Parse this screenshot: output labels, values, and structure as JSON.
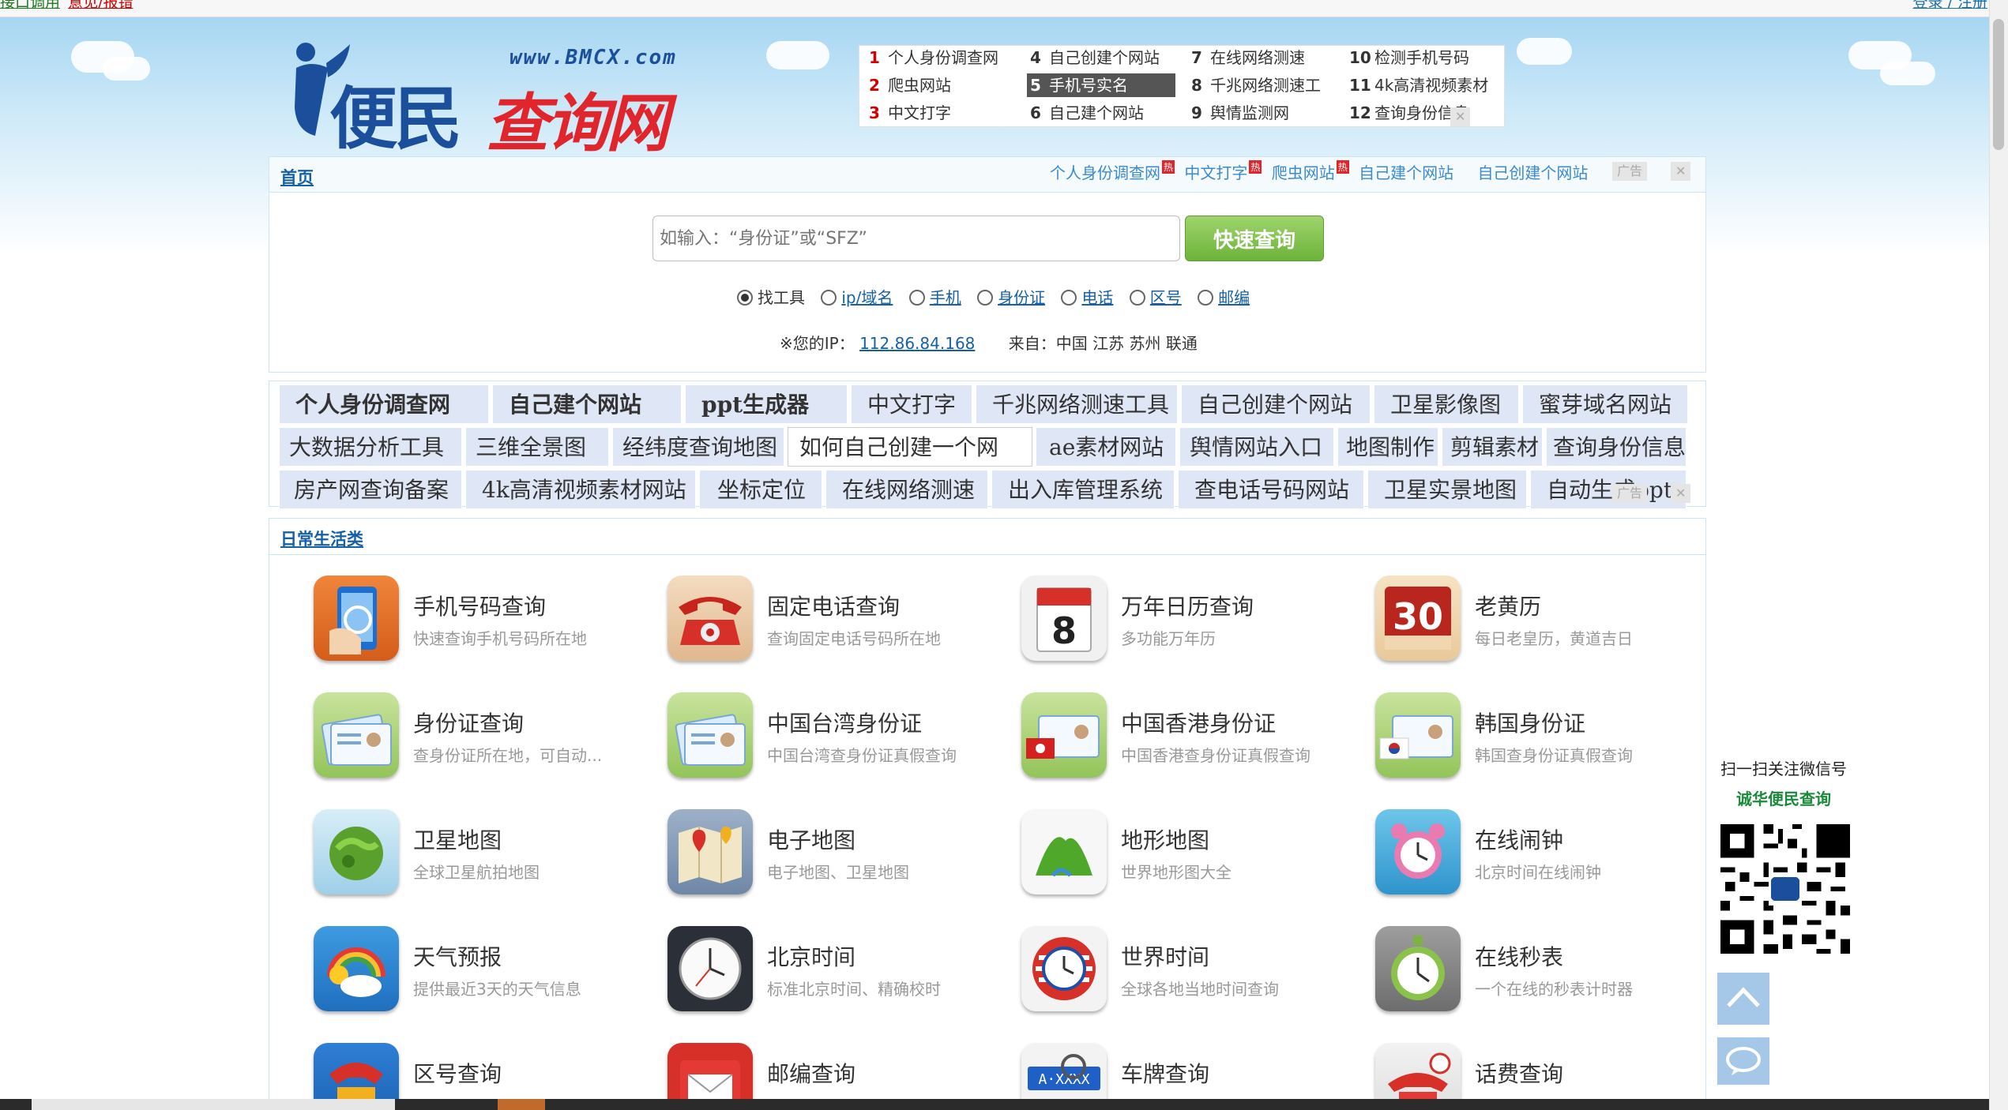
{
  "topbar": {
    "link1": "接口调用",
    "link2": "意见/报错",
    "login": "登录 / 注册"
  },
  "logo": {
    "url": "www.BMCX.com",
    "text1": "便民",
    "text2": "查询网"
  },
  "hotlist": [
    {
      "num": "1",
      "label": "个人身份调查网"
    },
    {
      "num": "2",
      "label": "爬虫网站"
    },
    {
      "num": "3",
      "label": "中文打字"
    },
    {
      "num": "4",
      "label": "自己创建个网站"
    },
    {
      "num": "5",
      "label": "手机号实名"
    },
    {
      "num": "6",
      "label": "自己建个网站"
    },
    {
      "num": "7",
      "label": "在线网络测速"
    },
    {
      "num": "8",
      "label": "千兆网络测速工"
    },
    {
      "num": "9",
      "label": "舆情监测网"
    },
    {
      "num": "10",
      "label": "检测手机号码"
    },
    {
      "num": "11",
      "label": "4k高清视频素材"
    },
    {
      "num": "12",
      "label": "查询身份信息"
    }
  ],
  "ad_label": "广告",
  "panel": {
    "home": "首页",
    "quick_links": [
      "个人身份调查网",
      "中文打字",
      "爬虫网站",
      "自己建个网站",
      "自己创建个网站"
    ],
    "search_placeholder": "如输入：“身份证”或“SFZ”",
    "search_button": "快速查询",
    "radio_options": [
      "找工具",
      "ip/域名",
      "手机",
      "身份证",
      "电话",
      "区号",
      "邮编"
    ],
    "ip_label": "※您的IP：",
    "ip_value": "112.86.84.168",
    "from_label": "来自：中国 江苏 苏州 联通"
  },
  "tags": [
    [
      "个人身份调查网",
      "自己建个网站",
      "ppt生成器",
      "中文打字",
      "千兆网络测速工具",
      "自己创建个网站",
      "卫星影像图",
      "蜜芽域名网站"
    ],
    [
      "大数据分析工具",
      "三维全景图",
      "经纬度查询地图",
      "如何自己创建一个网",
      "ae素材网站",
      "舆情网站入口",
      "地图制作",
      "剪辑素材",
      "查询身份信息"
    ],
    [
      "房产网查询备案",
      "4k高清视频素材网站",
      "坐标定位",
      "在线网络测速",
      "出入库管理系统",
      "查电话号码网站",
      "卫星实景地图",
      "自动生成ppt"
    ]
  ],
  "category": {
    "title": "日常生活类",
    "items": [
      {
        "title": "手机号码查询",
        "desc": "快速查询手机号码所在地",
        "icon": "phone-hand-icon"
      },
      {
        "title": "固定电话查询",
        "desc": "查询固定电话号码所在地",
        "icon": "red-telephone-icon"
      },
      {
        "title": "万年日历查询",
        "desc": "多功能万年历",
        "icon": "calendar-8-icon"
      },
      {
        "title": "老黄历",
        "desc": "每日老皇历，黄道吉日",
        "icon": "calendar-30-icon"
      },
      {
        "title": "身份证查询",
        "desc": "查身份证所在地，可自动...",
        "icon": "id-card-icon"
      },
      {
        "title": "中国台湾身份证",
        "desc": "中国台湾查身份证真假查询",
        "icon": "id-card-icon"
      },
      {
        "title": "中国香港身份证",
        "desc": "中国香港查身份证真假查询",
        "icon": "id-card-hk-icon"
      },
      {
        "title": "韩国身份证",
        "desc": "韩国查身份证真假查询",
        "icon": "id-card-kr-icon"
      },
      {
        "title": "卫星地图",
        "desc": "全球卫星航拍地图",
        "icon": "globe-icon"
      },
      {
        "title": "电子地图",
        "desc": "电子地图、卫星地图",
        "icon": "map-pin-icon"
      },
      {
        "title": "地形地图",
        "desc": "世界地形图大全",
        "icon": "mountain-icon"
      },
      {
        "title": "在线闹钟",
        "desc": "北京时间在线闹钟",
        "icon": "alarm-clock-icon"
      },
      {
        "title": "天气预报",
        "desc": "提供最近3天的天气信息",
        "icon": "weather-rainbow-icon"
      },
      {
        "title": "北京时间",
        "desc": "标准北京时间、精确校时",
        "icon": "clock-icon"
      },
      {
        "title": "世界时间",
        "desc": "全球各地当地时间查询",
        "icon": "world-clock-icon"
      },
      {
        "title": "在线秒表",
        "desc": "一个在线的秒表计时器",
        "icon": "stopwatch-icon"
      },
      {
        "title": "区号查询",
        "desc": "",
        "icon": "area-code-phone-icon"
      },
      {
        "title": "邮编查询",
        "desc": "",
        "icon": "mailbox-icon"
      },
      {
        "title": "车牌查询",
        "desc": "",
        "icon": "license-plate-icon"
      },
      {
        "title": "话费查询",
        "desc": "",
        "icon": "phone-bill-icon"
      }
    ]
  },
  "side": {
    "scan_text": "扫一扫关注微信号",
    "brand": "诚华便民查询"
  }
}
